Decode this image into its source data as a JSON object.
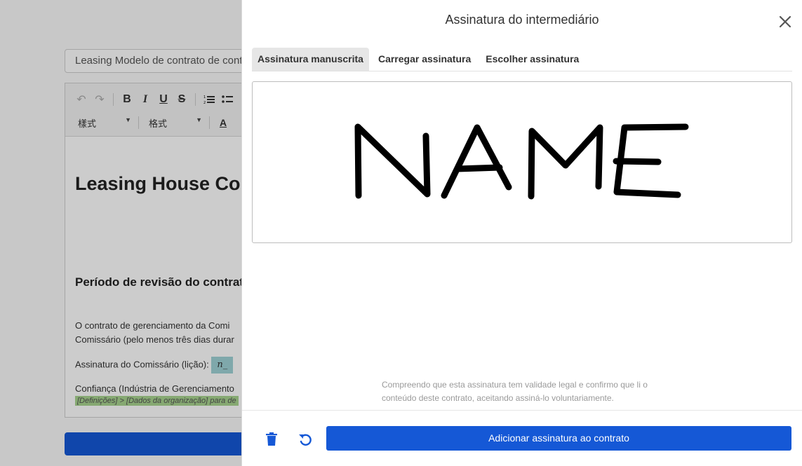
{
  "background": {
    "document_title_value": "Leasing Modelo de contrato de cont",
    "toolbar": {
      "style_select": "樣式",
      "format_select": "格式"
    },
    "doc": {
      "heading": "Leasing House Con",
      "section_heading": "Período de revisão do contrat",
      "paragraph_line1": "O contrato de gerenciamento da Comi",
      "paragraph_line2": "Comissário (pelo menos três dias durar",
      "signature_label": "Assinatura do Comissário (lição):",
      "signature_chip": "n_",
      "trust_line": "Confiança (Indústria de Gerenciamento",
      "hint_text": "[Definições] > [Dados da organização] para de"
    }
  },
  "modal": {
    "title": "Assinatura do intermediário",
    "tabs": [
      {
        "label": "Assinatura manuscrita",
        "active": true
      },
      {
        "label": "Carregar assinatura",
        "active": false
      },
      {
        "label": "Escolher assinatura",
        "active": false
      }
    ],
    "legal_line1": "Compreendo que esta assinatura tem validade legal e confirmo que li o",
    "legal_line2": "conteúdo deste contrato, aceitando assiná-lo voluntariamente.",
    "submit_label": "Adicionar assinatura ao contrato",
    "accent_color": "#1558d6",
    "icons": {
      "close": "close-icon",
      "delete": "trash-icon",
      "undo": "undo-icon"
    }
  }
}
